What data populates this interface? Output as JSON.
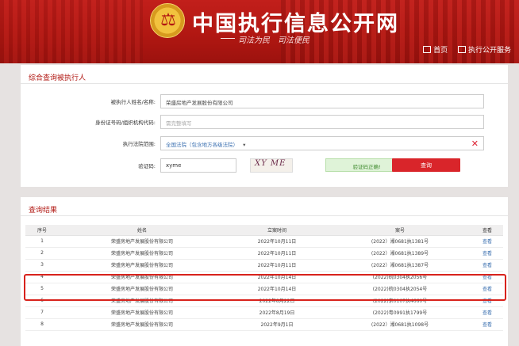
{
  "header": {
    "site_title": "中国执行信息公开网",
    "slogan": "司法为民　司法便民",
    "nav": [
      {
        "label": "首页",
        "icon": "home-icon"
      },
      {
        "label": "执行公开服务",
        "icon": "building-icon"
      }
    ],
    "emblem_char": "⚖"
  },
  "query": {
    "title": "综合查询被执行人",
    "name_label": "被执行人姓名/名称:",
    "name_value": "荣盛房地产发展股份有限公司",
    "id_label": "身份证号码/组织机构代码:",
    "id_placeholder": "需完整填写",
    "court_label": "执行法院范围:",
    "court_value": "全国法院（包含地方各级法院）",
    "court_caret": "▾",
    "clear_icon": "✕",
    "code_label": "验证码:",
    "code_value": "xyme",
    "captcha_text": "XY ME",
    "verify_ok_label": "验证码正确!",
    "search_label": "查询"
  },
  "results": {
    "title": "查询结果",
    "columns": [
      "序号",
      "姓名",
      "立案时间",
      "案号",
      "查看"
    ],
    "rows": [
      {
        "no": "1",
        "name": "荣盛房地产发展股份有限公司",
        "date": "2022年10月11日",
        "case": "(2022）湘0681执1381号",
        "view": "查看"
      },
      {
        "no": "2",
        "name": "荣盛房地产发展股份有限公司",
        "date": "2022年10月11日",
        "case": "(2022）湘0681执1389号",
        "view": "查看"
      },
      {
        "no": "3",
        "name": "荣盛房地产发展股份有限公司",
        "date": "2022年10月11日",
        "case": "(2022）湘0681执1387号",
        "view": "查看"
      },
      {
        "no": "4",
        "name": "荣盛房地产发展股份有限公司",
        "date": "2022年10月14日",
        "case": "(2022)皖0304执2056号",
        "view": "查看"
      },
      {
        "no": "5",
        "name": "荣盛房地产发展股份有限公司",
        "date": "2022年10月14日",
        "case": "(2022)皖0304执2054号",
        "view": "查看"
      },
      {
        "no": "6",
        "name": "荣盛房地产发展股份有限公司",
        "date": "2022年8月22日",
        "case": "(2022)京0107执4660号",
        "view": "查看"
      },
      {
        "no": "7",
        "name": "荣盛房地产发展股份有限公司",
        "date": "2022年8月19日",
        "case": "(2022)粤0991执1799号",
        "view": "查看"
      },
      {
        "no": "8",
        "name": "荣盛房地产发展股份有限公司",
        "date": "2022年9月1日",
        "case": "(2022）湘0681执1098号",
        "view": "查看"
      }
    ]
  }
}
